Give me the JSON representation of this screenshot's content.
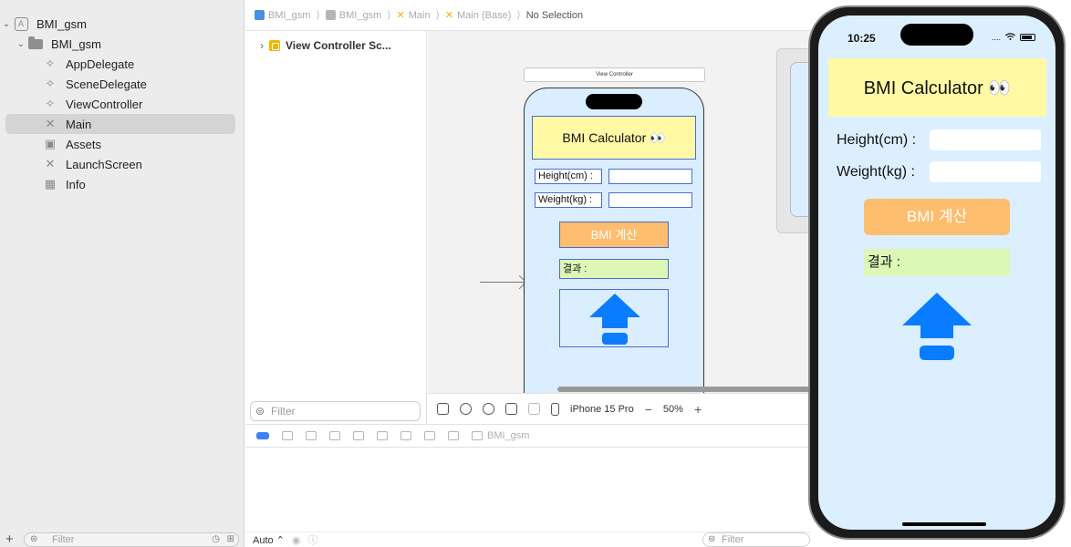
{
  "navigator": {
    "items": [
      {
        "label": "BMI_gsm",
        "kind": "project",
        "disclosure": "⌄"
      },
      {
        "label": "BMI_gsm",
        "kind": "folder",
        "disclosure": "⌄"
      },
      {
        "label": "AppDelegate",
        "kind": "swift"
      },
      {
        "label": "SceneDelegate",
        "kind": "swift"
      },
      {
        "label": "ViewController",
        "kind": "swift"
      },
      {
        "label": "Main",
        "kind": "storyboard",
        "selected": true
      },
      {
        "label": "Assets",
        "kind": "assets"
      },
      {
        "label": "LaunchScreen",
        "kind": "storyboard"
      },
      {
        "label": "Info",
        "kind": "plist"
      }
    ],
    "filter_placeholder": "Filter",
    "add_label": "+"
  },
  "jumpbar": {
    "crumbs": [
      "BMI_gsm",
      "BMI_gsm",
      "Main",
      "Main (Base)",
      "No Selection"
    ]
  },
  "outline": {
    "scene_label": "View Controller Sc...",
    "filter_placeholder": "Filter"
  },
  "canvas": {
    "scene_title": "View Controller",
    "ui": {
      "title": "BMI Calculator 👀",
      "height_label": "Height(cm) :",
      "weight_label": "Weight(kg) :",
      "button_label": "BMI 계산",
      "result_label": "결과 :"
    }
  },
  "canvas_toolbar": {
    "device": "iPhone 15 Pro",
    "zoom": "50%",
    "zoom_out": "−",
    "zoom_in": "+"
  },
  "debug_bar": {
    "target": "BMI_gsm"
  },
  "console": {
    "mode": "Auto ⌃",
    "filter_placeholder": "Filter"
  },
  "simulator": {
    "time": "10:25",
    "status_dots": "....",
    "wifi": "✆",
    "title": "BMI Calculator 👀",
    "height_label": "Height(cm) :",
    "weight_label": "Weight(kg) :",
    "button_label": "BMI 계산",
    "result_label": "결과 :"
  },
  "colors": {
    "accent_blue": "#0a7cff",
    "title_bg": "#fff9a6",
    "button_bg": "#fdbd6e",
    "result_bg": "#ddf7b6",
    "screen_bg": "#dcefff"
  }
}
